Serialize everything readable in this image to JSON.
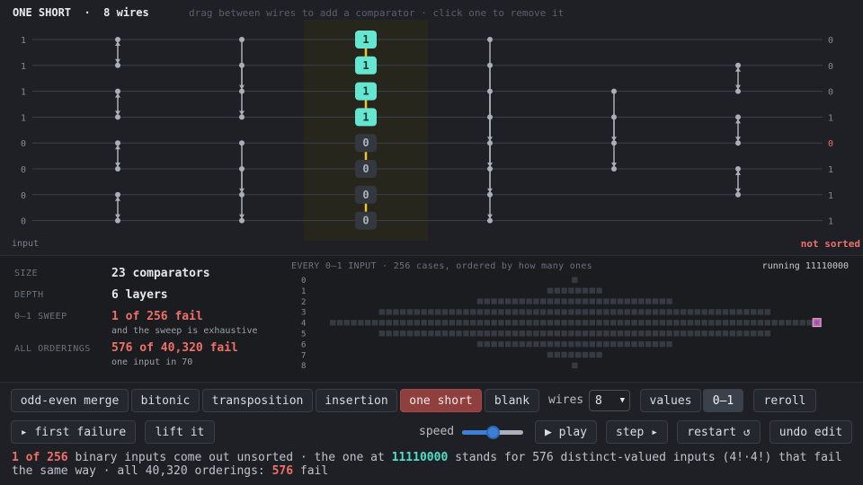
{
  "header": {
    "title": "ONE SHORT  ·  8 wires",
    "hint": "drag between wires to add a comparator · click one to remove it"
  },
  "network": {
    "inputs": [
      "1",
      "1",
      "1",
      "1",
      "0",
      "0",
      "0",
      "0"
    ],
    "outputs": [
      "0",
      "0",
      "0",
      "1",
      "0",
      "1",
      "1",
      "1"
    ],
    "output_flag_index": 4,
    "layers": [
      [
        [
          0,
          1
        ],
        [
          2,
          3
        ],
        [
          4,
          5
        ],
        [
          6,
          7
        ]
      ],
      [
        [
          0,
          2
        ],
        [
          1,
          3
        ],
        [
          4,
          6
        ],
        [
          5,
          7
        ]
      ],
      [
        [
          0,
          4
        ],
        [
          1,
          5
        ],
        [
          2,
          6
        ],
        [
          3,
          7
        ]
      ],
      [
        [
          2,
          4
        ],
        [
          3,
          5
        ]
      ],
      [
        [
          1,
          2
        ],
        [
          3,
          4
        ],
        [
          5,
          6
        ]
      ]
    ],
    "highlight_layer_values": [
      "1",
      "1",
      "1",
      "1",
      "0",
      "0",
      "0",
      "0"
    ],
    "input_label": "input",
    "status": "not sorted",
    "colors": {
      "highlight_node": "#64e6d0",
      "zero_node": "#33373f",
      "edge": "#f2c12e",
      "wire": "#3d4149",
      "comparator": "#a9aeb7",
      "fail": "#f07067"
    }
  },
  "stats": {
    "size_label": "SIZE",
    "size_value": "23 comparators",
    "depth_label": "DEPTH",
    "depth_value": "6 layers",
    "sweep_label": "0–1 SWEEP",
    "sweep_value": "1 of 256 fail",
    "sweep_sub": "and the sweep is exhaustive",
    "orderings_label": "ALL ORDERINGS",
    "orderings_value": "576 of 40,320 fail",
    "orderings_sub": "one input in 70"
  },
  "sweep": {
    "caption": "EVERY 0–1 INPUT · 256 cases, ordered by how many ones",
    "running": "running 11110000",
    "row_labels": [
      "0",
      "1",
      "2",
      "3",
      "4",
      "5",
      "6",
      "7",
      "8"
    ],
    "row_counts": [
      1,
      8,
      28,
      56,
      70,
      56,
      28,
      8,
      1
    ],
    "failing_row": 4,
    "failing_index": 69
  },
  "controls": {
    "presets": [
      "odd-even merge",
      "bitonic",
      "transposition",
      "insertion",
      "one short",
      "blank"
    ],
    "active_preset": "one short",
    "wires_label": "wires",
    "wires_value": "8",
    "values_label": "values",
    "mode_label": "0–1",
    "reroll": "reroll",
    "first_failure": "▸ first failure",
    "lift_it": "lift it",
    "speed_label": "speed",
    "speed_level": 0.5,
    "play": "▶ play",
    "step": "step ▸",
    "restart": "restart ↺",
    "undo": "undo edit"
  },
  "footer": {
    "fail_count": "1 of 256",
    "t1": " binary inputs come out unsorted  ·  the one at ",
    "pattern": "11110000",
    "t2": " stands for 576 distinct-valued inputs (4!·4!) that fail the same way  ·  all 40,320 orderings: ",
    "orderings_fail": "576",
    "t3": " fail"
  }
}
